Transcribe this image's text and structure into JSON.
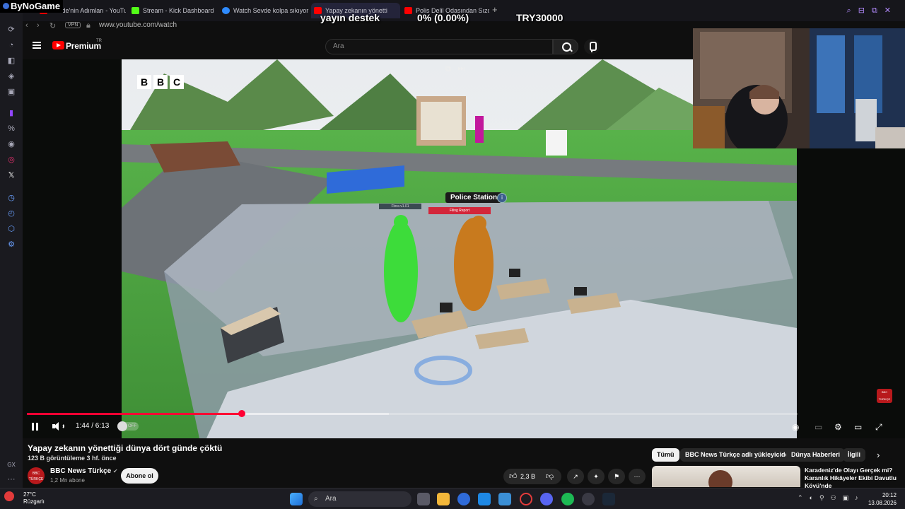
{
  "browser": {
    "brand": "ByNoGame",
    "tabs": [
      {
        "label": "Sevde'nin Adımları - YouTu",
        "fav_color": "#ff0000"
      },
      {
        "label": "Stream - Kick Dashboard",
        "fav_color": "#53fc18"
      },
      {
        "label": "Watch Sevde kolpa sıkıyor",
        "fav_color": "#2f8bff"
      },
      {
        "label": "Yapay zekanın yönetti",
        "fav_color": "#ff0000",
        "active": true
      },
      {
        "label": "Polis Delil Odasından Sızdı",
        "fav_color": "#ff0000"
      }
    ],
    "newtab": "+",
    "vpn": "VPN",
    "url": "www.youtube.com/watch"
  },
  "stream_overlay": {
    "left": "yayın destek",
    "center": "0% (0.00%)",
    "right": "TRY30000"
  },
  "youtube": {
    "brand": "Premium",
    "region": "TR",
    "search_placeholder": "Ara"
  },
  "video": {
    "bbc_letters": [
      "B",
      "B",
      "C"
    ],
    "scene_labels": {
      "police_station": "Police Station",
      "info": "i",
      "filing": "Filing Report",
      "flora": "Flora v1.01"
    },
    "badge": "BBC TÜRKÇE",
    "time": "1:44 / 6:13",
    "progress_fraction": 0.279,
    "buffer_fraction": 0.47,
    "autoplay": "OFF"
  },
  "details": {
    "title": "Yapay zekanın yönettiği dünya dört günde çöktü",
    "meta": "123 B görüntüleme  3 hf. önce",
    "channel": "BBC News Türkçe",
    "subs": "1,2 Mn abone",
    "subscribe": "Abone ol",
    "likes": "2,3 B"
  },
  "chips": [
    "Tümü",
    "BBC News Türkçe adlı yükleyiciden",
    "Dünya Haberleri",
    "İlgili"
  ],
  "recommended": {
    "title": "Karadeniz'de Olayı Gerçek mi? Karanlık Hikâyeler Ekibi Davutlu Köyü'nde"
  },
  "taskbar": {
    "temp": "27°C",
    "weather": "Rüzgarlı",
    "search": "Ara",
    "time": "20:12",
    "date": "13.08.2026"
  }
}
